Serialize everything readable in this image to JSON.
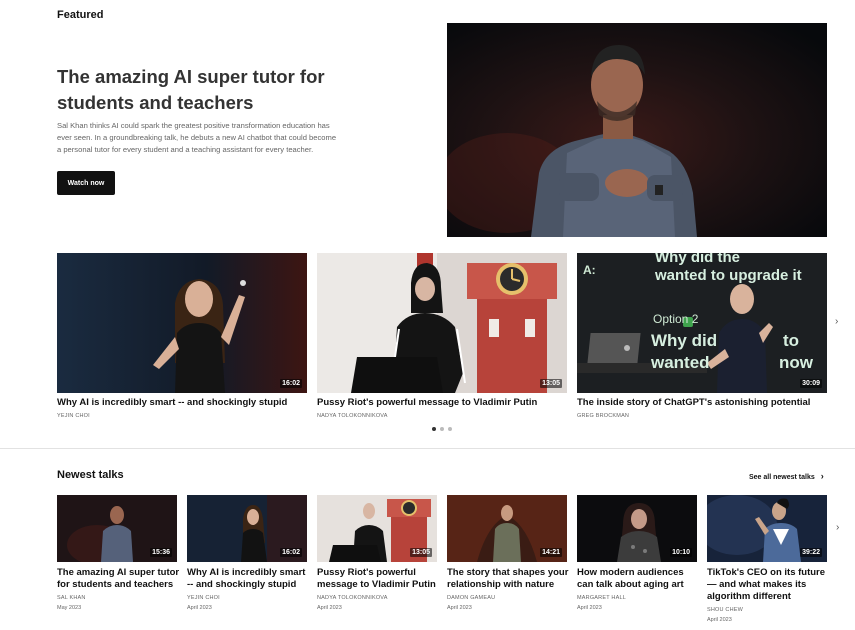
{
  "featured": {
    "section_label": "Featured",
    "title_line1": "The amazing AI super tutor for",
    "title_line2": "students and teachers",
    "desc_line1": "Sal Khan thinks AI could spark the greatest positive transformation education has",
    "desc_line2": "ever seen. In a groundbreaking talk, he debuts a new AI chatbot that could become",
    "desc_line3": "a personal tutor for every student and a teaching assistant for every teacher.",
    "watch_label": "Watch now"
  },
  "carousel": {
    "items": [
      {
        "title": "Why AI is incredibly smart -- and shockingly stupid",
        "speaker": "YEJIN CHOI",
        "duration": "16:02"
      },
      {
        "title": "Pussy Riot's powerful message to Vladimir Putin",
        "speaker": "NADYA TOLOKONNIKOVA",
        "duration": "13:05"
      },
      {
        "title": "The inside story of ChatGPT's astonishing potential",
        "speaker": "GREG BROCKMAN",
        "duration": "30:09"
      }
    ],
    "slide_text": {
      "a": "A:",
      "line1": "Why did the",
      "line2": "wanted to upgrade it",
      "option": "Option 2",
      "line3": "Why did",
      "line4": "wanted",
      "line3b": "to",
      "line4b": "now"
    },
    "next_icon": "chevron-right-icon",
    "dots_count": 3,
    "active_dot": 0
  },
  "newest": {
    "heading": "Newest talks",
    "see_all": "See all newest talks",
    "items": [
      {
        "title1": "The amazing AI super tutor",
        "title2": "for students and teachers",
        "title3": "",
        "speaker": "SAL KHAN",
        "date": "May 2023",
        "duration": "15:36"
      },
      {
        "title1": "Why AI is incredibly smart",
        "title2": "-- and shockingly stupid",
        "title3": "",
        "speaker": "YEJIN CHOI",
        "date": "April 2023",
        "duration": "16:02"
      },
      {
        "title1": "Pussy Riot's powerful",
        "title2": "message to Vladimir Putin",
        "title3": "",
        "speaker": "NADYA TOLOKONNIKOVA",
        "date": "April 2023",
        "duration": "13:05"
      },
      {
        "title1": "The story that shapes your",
        "title2": "relationship with nature",
        "title3": "",
        "speaker": "DAMON GAMEAU",
        "date": "April 2023",
        "duration": "14:21"
      },
      {
        "title1": "How modern audiences",
        "title2": "can talk about aging art",
        "title3": "",
        "speaker": "MARGARET HALL",
        "date": "April 2023",
        "duration": "10:10"
      },
      {
        "title1": "TikTok's CEO on its future",
        "title2": "— and what makes its",
        "title3": "algorithm different",
        "speaker": "SHOU CHEW",
        "date": "April 2023",
        "duration": "39:22"
      }
    ]
  },
  "colors": {
    "button_bg": "#111111",
    "divider": "#e2e2e2",
    "dot_active": "#333333",
    "dot_inactive": "#bbbbbb"
  }
}
